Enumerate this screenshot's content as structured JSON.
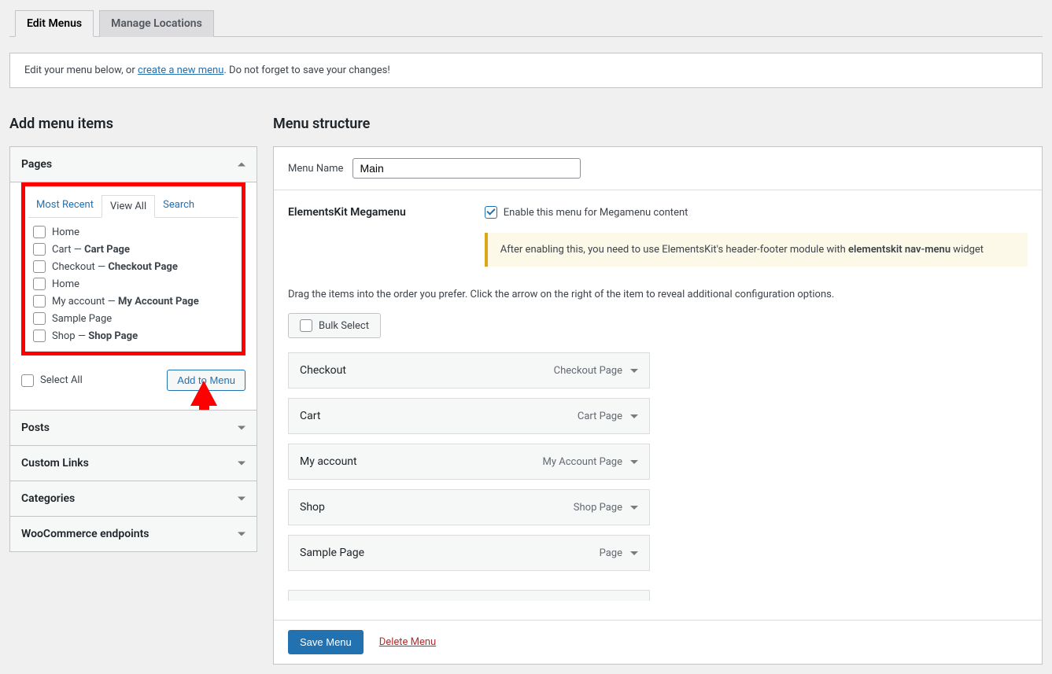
{
  "tabs": {
    "edit": "Edit Menus",
    "locations": "Manage Locations"
  },
  "notice": {
    "prefix": "Edit your menu below, or ",
    "create_link": "create a new menu",
    "suffix": ". Do not forget to save your changes!"
  },
  "add_items": {
    "heading": "Add menu items",
    "sections": {
      "pages": "Pages",
      "posts": "Posts",
      "custom_links": "Custom Links",
      "categories": "Categories",
      "woo": "WooCommerce endpoints"
    },
    "inner_tabs": {
      "recent": "Most Recent",
      "view_all": "View All",
      "search": "Search"
    },
    "pages_list": [
      {
        "label": "Home"
      },
      {
        "label": "Cart",
        "suffix": " — ",
        "bold": "Cart Page"
      },
      {
        "label": "Checkout",
        "suffix": " — ",
        "bold": "Checkout Page"
      },
      {
        "label": "Home"
      },
      {
        "label": "My account",
        "suffix": " — ",
        "bold": "My Account Page"
      },
      {
        "label": "Sample Page"
      },
      {
        "label": "Shop",
        "suffix": " — ",
        "bold": "Shop Page"
      }
    ],
    "select_all": "Select All",
    "add_to_menu": "Add to Menu"
  },
  "structure": {
    "heading": "Menu structure",
    "menu_name_label": "Menu Name",
    "menu_name_value": "Main",
    "megamenu_label": "ElementsKit Megamenu",
    "enable_label": "Enable this menu for Megamenu content",
    "notice_prefix": "After enabling this, you need to use ElementsKit's header-footer module with ",
    "notice_bold": "elementskit nav-menu",
    "notice_suffix": " widget",
    "drag_desc": "Drag the items into the order you prefer. Click the arrow on the right of the item to reveal additional configuration options.",
    "bulk_select": "Bulk Select",
    "items": [
      {
        "title": "Checkout",
        "type": "Checkout Page"
      },
      {
        "title": "Cart",
        "type": "Cart Page"
      },
      {
        "title": "My account",
        "type": "My Account Page"
      },
      {
        "title": "Shop",
        "type": "Shop Page"
      },
      {
        "title": "Sample Page",
        "type": "Page"
      }
    ],
    "save": "Save Menu",
    "delete": "Delete Menu"
  }
}
